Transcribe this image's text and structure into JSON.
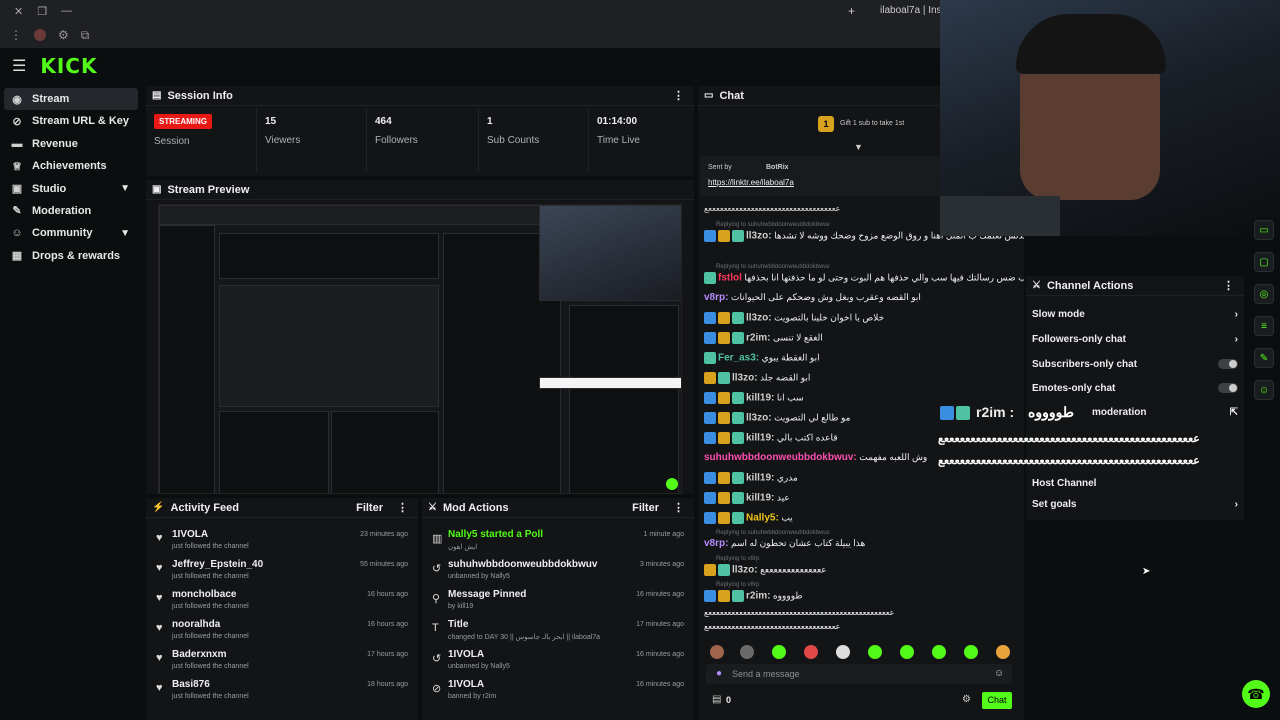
{
  "browser": {
    "tab_title": "ilaboal7a | Instagram",
    "new_tab": "+"
  },
  "brand": {
    "logo": "KICK",
    "accent": "#53fc18",
    "live_color": "#e91916"
  },
  "sidebar": {
    "items": [
      {
        "label": "Stream",
        "icon": "broadcast-icon"
      },
      {
        "label": "Stream URL & Key",
        "icon": "link-icon"
      },
      {
        "label": "Revenue",
        "icon": "money-icon"
      },
      {
        "label": "Achievements",
        "icon": "trophy-icon"
      },
      {
        "label": "Studio",
        "icon": "camera-icon"
      },
      {
        "label": "Moderation",
        "icon": "wrench-icon"
      },
      {
        "label": "Community",
        "icon": "people-icon"
      },
      {
        "label": "Drops & rewards",
        "icon": "gift-icon"
      }
    ]
  },
  "session": {
    "title": "Session Info",
    "live_badge": "STREAMING",
    "session_label": "Session",
    "stats": [
      {
        "value": "15",
        "label": "Viewers"
      },
      {
        "value": "464",
        "label": "Followers"
      },
      {
        "value": "1",
        "label": "Sub Counts"
      },
      {
        "value": "01:14:00",
        "label": "Time Live"
      }
    ]
  },
  "preview": {
    "title": "Stream Preview"
  },
  "activity": {
    "title": "Activity Feed",
    "filter": "Filter",
    "items": [
      {
        "name": "1IVOLA",
        "sub": "just followed the channel",
        "time": "23 minutes ago"
      },
      {
        "name": "Jeffrey_Epstein_40",
        "sub": "just followed the channel",
        "time": "55 minutes ago"
      },
      {
        "name": "moncholbace",
        "sub": "just followed the channel",
        "time": "16 hours ago"
      },
      {
        "name": "nooralhda",
        "sub": "just followed the channel",
        "time": "16 hours ago"
      },
      {
        "name": "Baderxnxm",
        "sub": "just followed the channel",
        "time": "17 hours ago"
      },
      {
        "name": "Basi876",
        "sub": "just followed the channel",
        "time": "18 hours ago"
      }
    ]
  },
  "mod": {
    "title": "Mod Actions",
    "filter": "Filter",
    "items": [
      {
        "name": "Nally5 started a Poll",
        "sub": "ايش اهون",
        "time": "1 minute ago",
        "icon": "poll-icon"
      },
      {
        "name": "suhuhwbbdoonweubbdokbwuv",
        "sub": "unbanned by Nally5",
        "time": "3 minutes ago",
        "icon": "undo-icon"
      },
      {
        "name": "Message Pinned",
        "sub": "by kill19",
        "time": "16 minutes ago",
        "icon": "pin-icon"
      },
      {
        "name": "Title",
        "sub": "changed to DAY 30 || ابحر بالـ جاسوس || ilaboal7a",
        "time": "17 minutes ago",
        "icon": "title-icon"
      },
      {
        "name": "1IVOLA",
        "sub": "unbanned by Nally5",
        "time": "16 minutes ago",
        "icon": "undo-icon"
      },
      {
        "name": "1IVOLA",
        "sub": "banned by r2im",
        "time": "16 minutes ago",
        "icon": "ban-icon"
      }
    ]
  },
  "chat": {
    "title": "Chat",
    "gift": "Gift 1 sub to take 1st",
    "gift_count": "1",
    "pinned_by": "Sent by",
    "pinned_user": "BotRix",
    "pinned_link": "https://linktr.ee/ilaboal7a",
    "placeholder": "Send a message",
    "send": "Chat",
    "count": "0",
    "lines": [
      {
        "user": "",
        "text": "ععععععععععععععععععععععععععععععععععع",
        "reply": ""
      },
      {
        "user": "ll3zo:",
        "text": "ريح بسببكم فلما ياكلون الدلس تعلمك ب المثل اهنا و روق الوضع مزوح وضحك ووشه لا تشدها",
        "reply": "Replying to suhuhwbbdoonweubbdokbwuv"
      },
      {
        "user": "fstlol",
        "text": "لا فيه سبب ضس رسالتك فيها سب والي حذفها هم البوت وحتى لو ما حذفتها انا بحذفها",
        "reply": "Replying to suhuhwbbdoonweubbdokbwuv"
      },
      {
        "user": "v8rp:",
        "text": "ابو القضه وعقرب وبغل وش وضحكم على الحيوانات",
        "reply": ""
      },
      {
        "user": "ll3zo:",
        "text": "خلاص يا اخوان خلينا بالتصويت",
        "reply": ""
      },
      {
        "user": "r2im:",
        "text": "الغقع لا تنسى",
        "reply": ""
      },
      {
        "user": "Fer_as3:",
        "text": "ابو الغقطة يبوي",
        "reply": ""
      },
      {
        "user": "ll3zo:",
        "text": "ابو القضه جلد",
        "reply": ""
      },
      {
        "user": "kill19:",
        "text": "سب انا",
        "reply": ""
      },
      {
        "user": "ll3zo:",
        "text": "مو طالع لي التصويت",
        "reply": ""
      },
      {
        "user": "kill19:",
        "text": "قاعده اكتب بالي",
        "reply": ""
      },
      {
        "user": "suhuhwbbdoonweubbdokbwuv:",
        "text": "وش اللعبه مفهمت",
        "reply": ""
      },
      {
        "user": "kill19:",
        "text": "مدري",
        "reply": ""
      },
      {
        "user": "kill19:",
        "text": "عيد",
        "reply": ""
      },
      {
        "user": "Nally5:",
        "text": "يب",
        "reply": ""
      },
      {
        "user": "v8rp:",
        "text": "هذا يبيلة كتاب عشان تحطون له اسم",
        "reply": "Replying to suhuhwbbdoonweubbdokbwuv"
      },
      {
        "user": "ll3zo:",
        "text": "ععععععععععععععع",
        "reply": "Replying to v8rp"
      },
      {
        "user": "r2im:",
        "text": "طووووه",
        "reply": "Replying to v8rp"
      }
    ]
  },
  "actions": {
    "title": "Channel Actions",
    "items": [
      {
        "label": "Slow mode",
        "type": "arrow"
      },
      {
        "label": "Followers-only chat",
        "type": "arrow"
      },
      {
        "label": "Subscribers-only chat",
        "type": "toggle"
      },
      {
        "label": "Emotes-only chat",
        "type": "toggle"
      },
      {
        "label": "moderation",
        "type": "link"
      },
      {
        "label": "Host Channel",
        "type": "none"
      },
      {
        "label": "Set goals",
        "type": "arrow"
      }
    ]
  },
  "overlay": {
    "user": "r2im :",
    "text": "طووووه",
    "line1": "ععععععععععععععععععععععععععععععععععععععععععععععععع",
    "line2": "ععععععععععععععععععععععععععععععععععععععععععععععععع"
  }
}
